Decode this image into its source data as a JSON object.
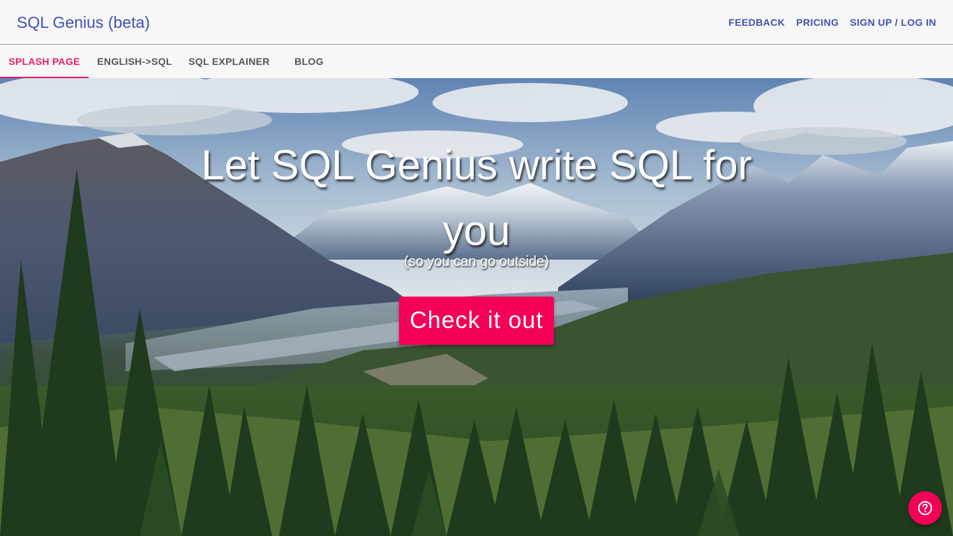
{
  "header": {
    "brand": "SQL Genius (beta)",
    "links": [
      "FEEDBACK",
      "PRICING",
      "SIGN UP / LOG IN"
    ]
  },
  "tabs": {
    "items": [
      "SPLASH PAGE",
      "ENGLISH->SQL",
      "SQL EXPLAINER",
      "BLOG"
    ],
    "active": "SPLASH PAGE"
  },
  "hero": {
    "headline": "Let SQL Genius write SQL for you",
    "subline": "(so you can go outside)",
    "cta_label": "Check it out",
    "background": "mountain-forest-landscape-photo"
  },
  "help": {
    "icon": "help-icon"
  },
  "colors": {
    "primary": "#3f51b5",
    "accent": "#f50057",
    "tab_active": "#e91e63"
  }
}
